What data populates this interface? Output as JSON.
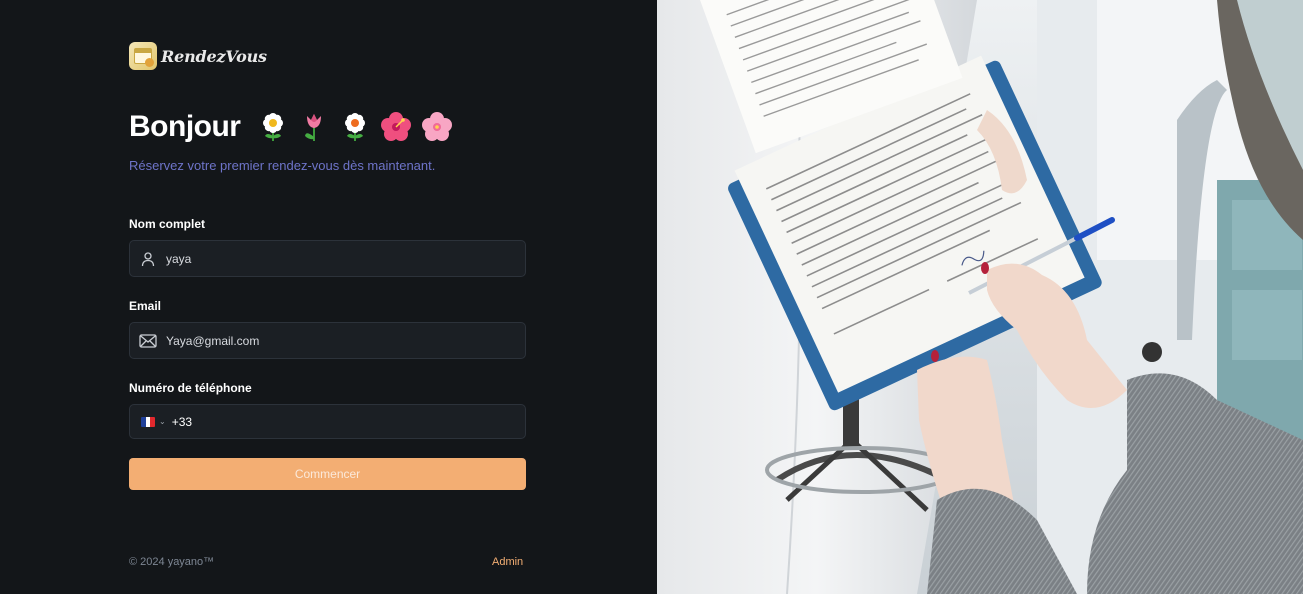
{
  "brand": {
    "name": "RendezVous",
    "logo_icon": "calendar-heart-logo"
  },
  "hero": {
    "title": "Bonjour",
    "emojis": [
      "daisy",
      "tulip",
      "daisy",
      "hibiscus",
      "cherry-blossom"
    ],
    "subtitle": "Réservez votre premier rendez-vous dès maintenant."
  },
  "form": {
    "name": {
      "label": "Nom complet",
      "value": "yaya",
      "icon": "user-icon"
    },
    "email": {
      "label": "Email",
      "value": "Yaya@gmail.com",
      "icon": "mail-icon"
    },
    "phone": {
      "label": "Numéro de téléphone",
      "country": "France",
      "value": "+33"
    },
    "submit": "Commencer"
  },
  "footer": {
    "copyright": "© 2024 yayano™",
    "admin_link": "Admin"
  },
  "colors": {
    "background": "#131619",
    "accent": "#f3ae73",
    "subtitle": "#6e74c9",
    "field_bg": "#1b1f24"
  },
  "image": {
    "description_icon": "medical-consultation-photo"
  }
}
